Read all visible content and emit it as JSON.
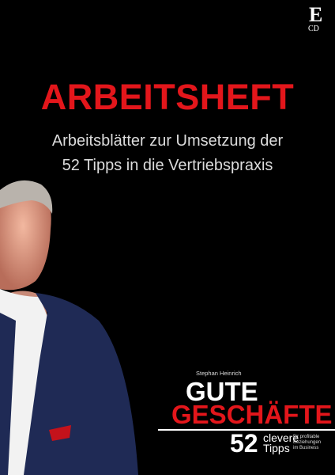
{
  "logo": {
    "letter": "E",
    "sub": "CD"
  },
  "title": "ARBEITSHEFT",
  "subtitle": [
    "Arbeitsblätter zur Umsetzung der",
    "52 Tipps in die Vertriebspraxis"
  ],
  "book": {
    "author": "Stephan Heinrich",
    "title_line1": "GUTE",
    "title_line2": "GESCHÄFTE",
    "number": "52",
    "word1": "clevere",
    "word2": "Tipps",
    "tagline": [
      "für profitable",
      "Beziehungen",
      "im Business"
    ]
  },
  "colors": {
    "accent": "#e3161b",
    "background": "#000000"
  }
}
